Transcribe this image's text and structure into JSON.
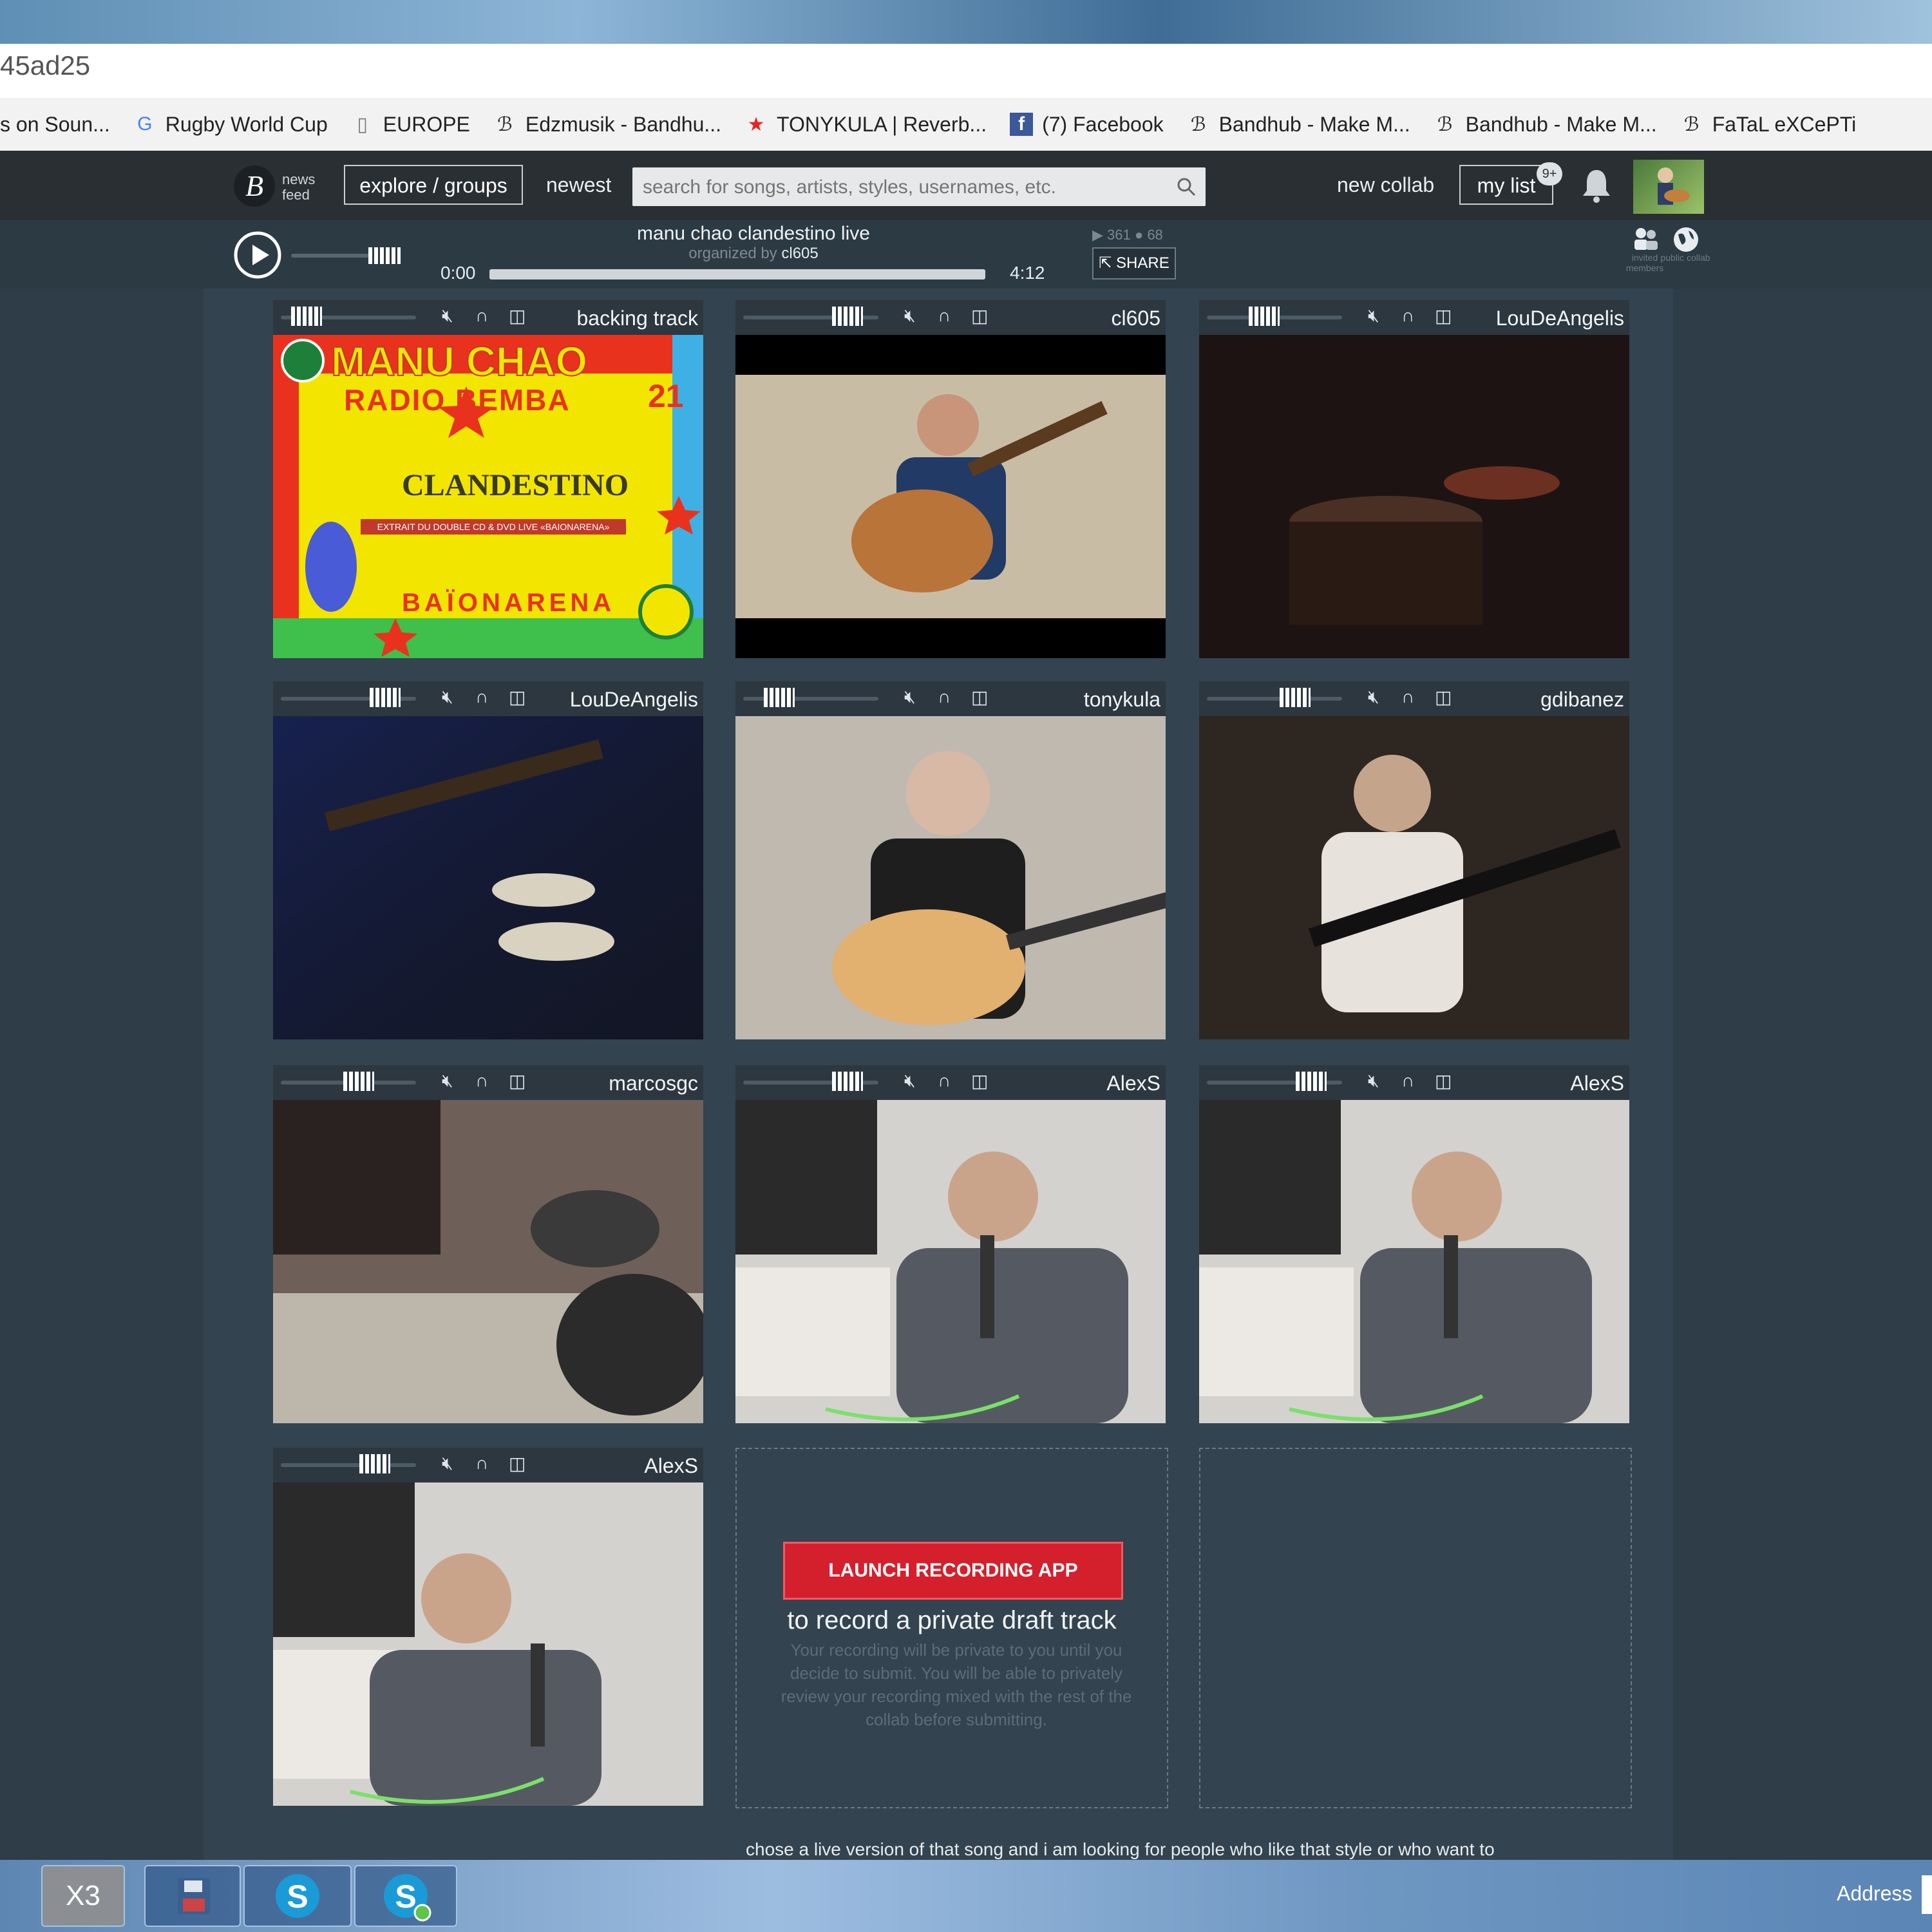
{
  "browser": {
    "address": "45ad25",
    "bookmarks": [
      {
        "icon": "soundcloud-icon",
        "label": "s on Soun..."
      },
      {
        "icon": "google-icon",
        "label": "Rugby World Cup"
      },
      {
        "icon": "page-icon",
        "label": "EUROPE"
      },
      {
        "icon": "bandhub-icon",
        "label": "Edzmusik - Bandhu..."
      },
      {
        "icon": "star-icon",
        "label": "TONYKULA | Reverb..."
      },
      {
        "icon": "facebook-icon",
        "label": "(7) Facebook"
      },
      {
        "icon": "bandhub-icon",
        "label": "Bandhub - Make M..."
      },
      {
        "icon": "bandhub-icon",
        "label": "Bandhub - Make M..."
      },
      {
        "icon": "bandhub-icon",
        "label": "FaTaL eXCePTi"
      }
    ]
  },
  "nav": {
    "logo_news": "news",
    "logo_feed": "feed",
    "explore_label": "explore / groups",
    "newest_label": "newest",
    "search_placeholder": "search for songs, artists, styles, usernames, etc.",
    "new_collab_label": "new collab",
    "my_list_label": "my list",
    "my_list_badge": "9+"
  },
  "player": {
    "title": "manu chao clandestino live",
    "organized_by_label": "organized by",
    "organizer": "cl605",
    "time_current": "0:00",
    "time_total": "4:12",
    "plays": "361",
    "comments": "68",
    "share_label": "SHARE",
    "invited_label": "invited members",
    "public_label": "public collab",
    "progress": 0.0
  },
  "tracks": [
    {
      "name": "backing track",
      "volume": 0.1
    },
    {
      "name": "cl605",
      "volume": 0.85
    },
    {
      "name": "LouDeAngelis",
      "volume": 0.4
    },
    {
      "name": "LouDeAngelis",
      "volume": 0.85
    },
    {
      "name": "tonykula",
      "volume": 0.2
    },
    {
      "name": "gdibanez",
      "volume": 0.7
    },
    {
      "name": "marcosgc",
      "volume": 0.6
    },
    {
      "name": "AlexS",
      "volume": 0.85
    },
    {
      "name": "AlexS",
      "volume": 0.85
    },
    {
      "name": "AlexS",
      "volume": 0.75
    }
  ],
  "poster": {
    "line1": "MANU CHAO",
    "line2": "RADIO BEMBA",
    "number": "21",
    "line3": "CLANDESTINO",
    "line4": "EXTRAIT DU DOUBLE CD & DVD LIVE «BAIONARENA»",
    "line5": "BAÏONARENA"
  },
  "recording": {
    "button": "LAUNCH RECORDING APP",
    "heading": "to record a private draft track",
    "description": "Your recording will be private to you until you decide to submit. You will be able to privately review your recording mixed with the rest of the collab before submitting."
  },
  "footer_text": "chose a live version of that song and i am looking for people who like that style or who  want to",
  "taskbar": {
    "x3_label": "X3",
    "address_label": "Address"
  },
  "colors": {
    "page_bg": "#33434f",
    "nav_bg": "#2a2f33",
    "launch_red": "#d4202c"
  }
}
